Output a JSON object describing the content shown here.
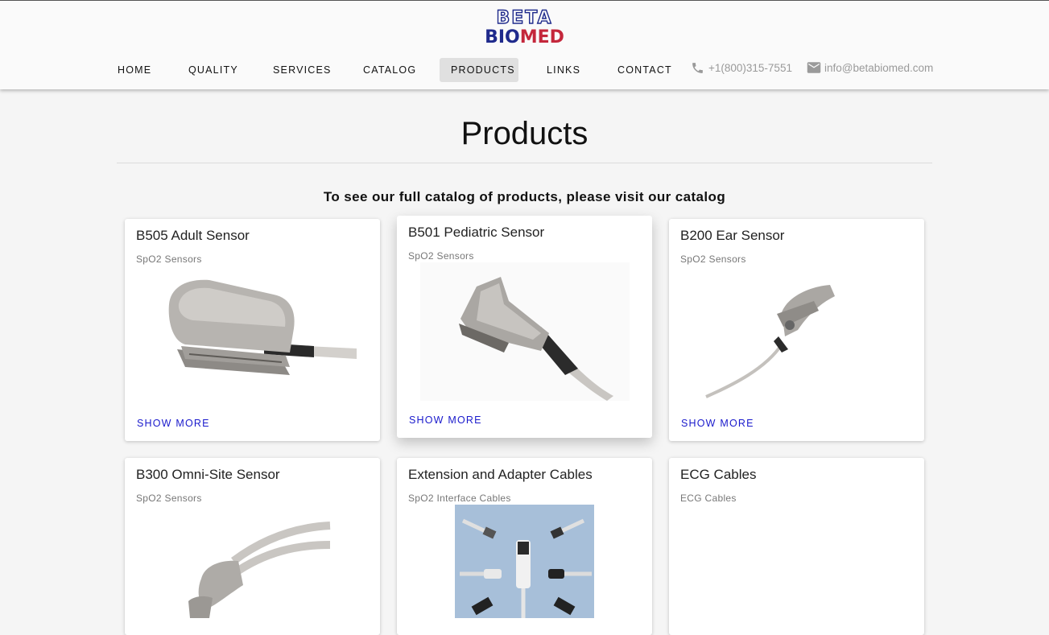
{
  "brand": {
    "logo_top": "BETA",
    "logo_bio": "BIO",
    "logo_med": "MED"
  },
  "nav": {
    "items": [
      {
        "label": "HOME"
      },
      {
        "label": "QUALITY"
      },
      {
        "label": "SERVICES"
      },
      {
        "label": "CATALOG"
      },
      {
        "label": "PRODUCTS",
        "active": true
      },
      {
        "label": "LINKS"
      },
      {
        "label": "CONTACT"
      }
    ],
    "phone": "+1(800)315-7551",
    "email": "info@betabiomed.com"
  },
  "page": {
    "title": "Products",
    "subtitle": "To see our full catalog of products, please visit our catalog"
  },
  "products": [
    {
      "title": "B505 Adult Sensor",
      "category": "SpO2 Sensors",
      "action": "SHOW MORE"
    },
    {
      "title": "B501 Pediatric Sensor",
      "category": "SpO2 Sensors",
      "action": "SHOW MORE"
    },
    {
      "title": "B200 Ear Sensor",
      "category": "SpO2 Sensors",
      "action": "SHOW MORE"
    },
    {
      "title": "B300 Omni-Site Sensor",
      "category": "SpO2 Sensors"
    },
    {
      "title": "Extension and Adapter Cables",
      "category": "SpO2 Interface Cables"
    },
    {
      "title": "ECG Cables",
      "category": "ECG Cables"
    }
  ],
  "colors": {
    "brand_blue": "#1f2a8c",
    "brand_red": "#c4273b",
    "link_blue": "#1a1acc",
    "active_nav_bg": "#e0e0e0"
  },
  "icons": {
    "phone": "phone-icon",
    "email": "email-icon"
  }
}
